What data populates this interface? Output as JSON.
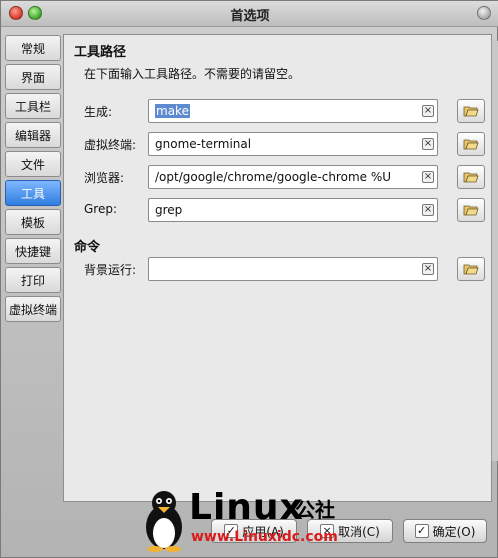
{
  "window": {
    "title": "首选项"
  },
  "sidebar": {
    "items": [
      {
        "label": "常规",
        "active": false
      },
      {
        "label": "界面",
        "active": false
      },
      {
        "label": "工具栏",
        "active": false
      },
      {
        "label": "编辑器",
        "active": false
      },
      {
        "label": "文件",
        "active": false
      },
      {
        "label": "工具",
        "active": true
      },
      {
        "label": "模板",
        "active": false
      },
      {
        "label": "快捷键",
        "active": false
      },
      {
        "label": "打印",
        "active": false
      },
      {
        "label": "虚拟终端",
        "active": false
      }
    ]
  },
  "main": {
    "tool_paths": {
      "heading": "工具路径",
      "description": "在下面输入工具路径。不需要的请留空。",
      "fields": [
        {
          "label": "生成:",
          "value": "make",
          "selected": true
        },
        {
          "label": "虚拟终端:",
          "value": "gnome-terminal"
        },
        {
          "label": "浏览器:",
          "value": "/opt/google/chrome/google-chrome %U"
        },
        {
          "label": "Grep:",
          "value": "grep"
        }
      ]
    },
    "commands": {
      "heading": "命令",
      "fields": [
        {
          "label": "背景运行:",
          "value": ""
        }
      ]
    }
  },
  "footer": {
    "apply_label": "应用(A)",
    "cancel_label": "取消(C)",
    "ok_label": "确定(O)"
  },
  "watermark": {
    "brand": "Linux",
    "brand_suffix": "公社",
    "url": "www.Linuxidc.com"
  },
  "colors": {
    "accent": "#3b82e6",
    "watermark_url": "#d91b1b"
  }
}
